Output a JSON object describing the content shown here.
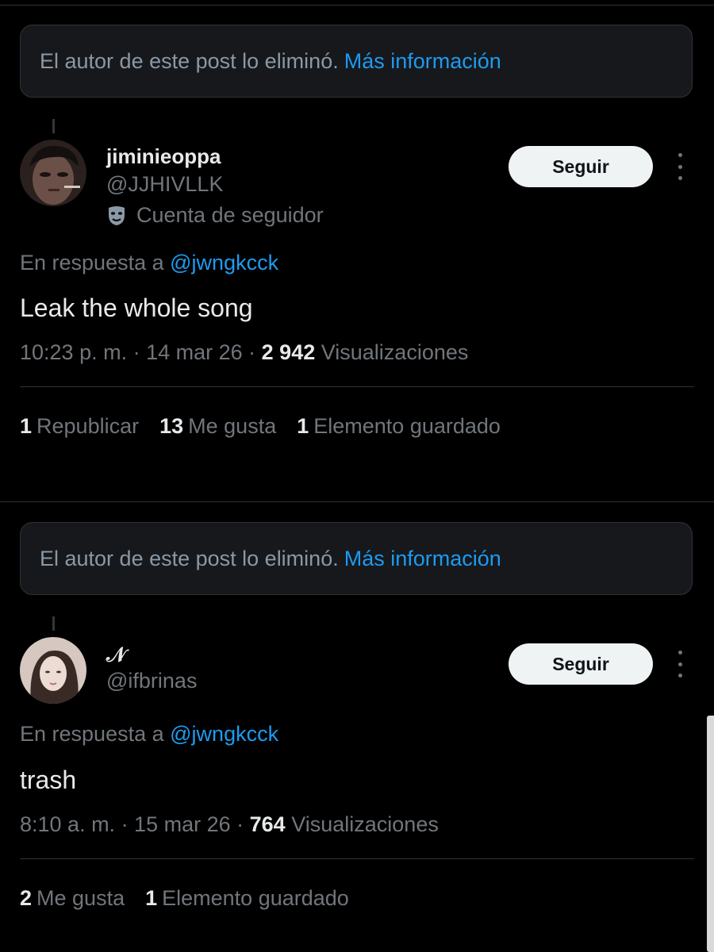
{
  "deleted_notice": {
    "text": "El autor de este post lo eliminó.",
    "link": "Más información"
  },
  "posts": [
    {
      "display_name": "jiminieoppa",
      "handle": "@JJHIVLLK",
      "account_label": "Cuenta de seguidor",
      "account_icon": "mask-icon",
      "follow_label": "Seguir",
      "reply_prefix": "En respuesta a",
      "reply_to": "@jwngkcck",
      "text": "Leak the whole song",
      "time": "10:23 p. m. · 14 mar 26 ·",
      "views": "2 942",
      "views_label": "Visualizaciones",
      "stats": [
        {
          "count": "1",
          "label": "Republicar"
        },
        {
          "count": "13",
          "label": "Me gusta"
        },
        {
          "count": "1",
          "label": "Elemento guardado"
        }
      ]
    },
    {
      "display_name": "𝒩",
      "handle": "@ifbrinas",
      "follow_label": "Seguir",
      "reply_prefix": "En respuesta a",
      "reply_to": "@jwngkcck",
      "text": "trash",
      "time": "8:10 a. m. · 15 mar 26 ·",
      "views": "764",
      "views_label": "Visualizaciones",
      "stats": [
        {
          "count": "2",
          "label": "Me gusta"
        },
        {
          "count": "1",
          "label": "Elemento guardado"
        }
      ]
    }
  ],
  "colors": {
    "background": "#000000",
    "accent": "#1d9bf0",
    "secondary_text": "#71767b",
    "primary_text": "#e7e9ea"
  }
}
